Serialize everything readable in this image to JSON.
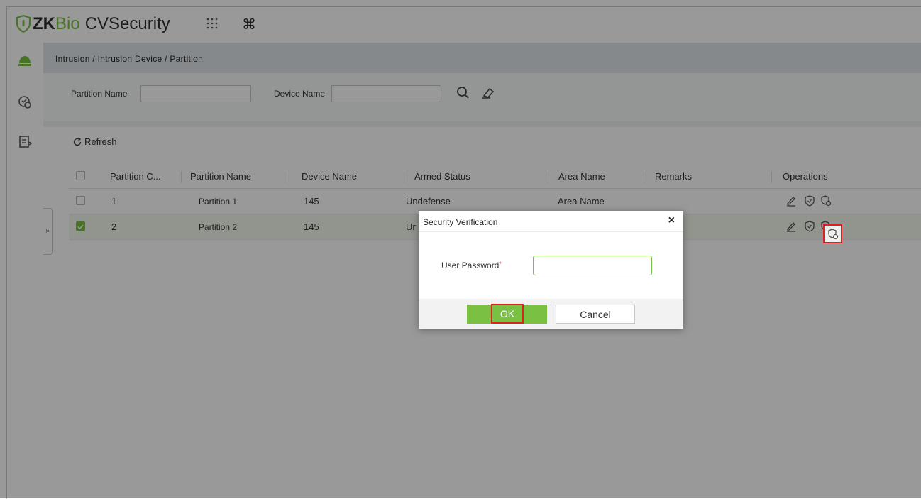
{
  "app": {
    "logo_zk": "ZK",
    "logo_bio": "Bio",
    "logo_rest": "CVSecurity",
    "brand_color": "#7ac143"
  },
  "header": {
    "apps_icon": "grid-icon",
    "shortcut_icon": "command-icon"
  },
  "rail": {
    "icons": [
      "intrusion-icon",
      "linkage-icon",
      "report-icon"
    ]
  },
  "breadcrumb": "Intrusion / Intrusion Device / Partition",
  "filter": {
    "partition_name_label": "Partition Name",
    "partition_name_value": "",
    "device_name_label": "Device Name",
    "device_name_value": ""
  },
  "toolbar": {
    "refresh_label": "Refresh"
  },
  "table": {
    "columns": [
      "Partition C...",
      "Partition Name",
      "Device Name",
      "Armed Status",
      "Area Name",
      "Remarks",
      "Operations"
    ],
    "rows": [
      {
        "checked": false,
        "code": "1",
        "partition_name": "Partition 1",
        "device_name": "145",
        "armed_status": "Undefense",
        "area_name": "Area Name",
        "remarks": ""
      },
      {
        "checked": true,
        "code": "2",
        "partition_name": "Partition 2",
        "device_name": "145",
        "armed_status": "Ur",
        "area_name": "",
        "remarks": ""
      }
    ]
  },
  "dialog": {
    "title": "Security Verification",
    "close": "×",
    "password_label": "User Password",
    "required_mark": "*",
    "password_value": "",
    "ok_label": "OK",
    "cancel_label": "Cancel"
  },
  "expander_glyph": "»"
}
